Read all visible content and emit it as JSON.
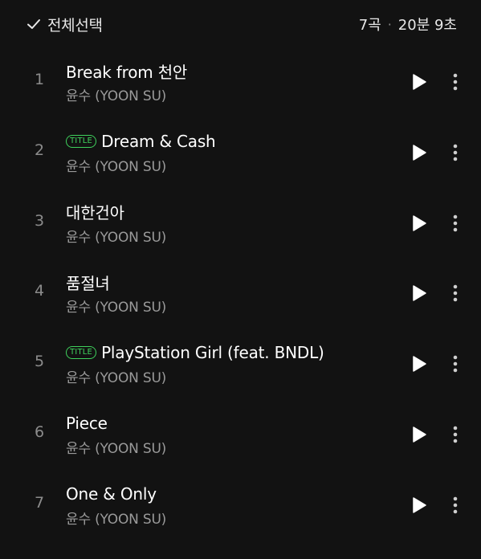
{
  "header": {
    "select_all_label": "전체선택",
    "track_count": "7곡",
    "separator": "·",
    "total_duration": "20분 9초"
  },
  "tracks": [
    {
      "number": "1",
      "title": "Break from 천안",
      "artist": "윤수 (YOON SU)",
      "badge": ""
    },
    {
      "number": "2",
      "title": "Dream & Cash",
      "artist": "윤수 (YOON SU)",
      "badge": "TITLE"
    },
    {
      "number": "3",
      "title": "대한건아",
      "artist": "윤수 (YOON SU)",
      "badge": ""
    },
    {
      "number": "4",
      "title": "품절녀",
      "artist": "윤수 (YOON SU)",
      "badge": ""
    },
    {
      "number": "5",
      "title": "PlayStation Girl (feat. BNDL)",
      "artist": "윤수 (YOON SU)",
      "badge": "TITLE"
    },
    {
      "number": "6",
      "title": "Piece",
      "artist": "윤수 (YOON SU)",
      "badge": ""
    },
    {
      "number": "7",
      "title": "One & Only",
      "artist": "윤수 (YOON SU)",
      "badge": ""
    }
  ],
  "icons": {
    "select_all": "check-icon",
    "play": "play-icon",
    "more": "more-vertical-icon"
  },
  "colors": {
    "background": "#121212",
    "badge": "#3fd15c",
    "primary_text": "#ffffff",
    "secondary_text": "#9a9a9a"
  }
}
